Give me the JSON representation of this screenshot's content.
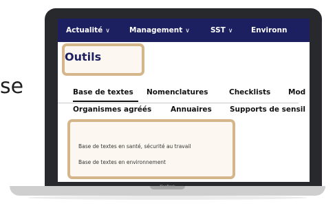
{
  "side_text": "se",
  "nav": {
    "items": [
      {
        "label": "Actualité",
        "chevron": "∨"
      },
      {
        "label": "Management",
        "chevron": "∨"
      },
      {
        "label": "SST",
        "chevron": "∨"
      },
      {
        "label": "Environn",
        "chevron": ""
      }
    ]
  },
  "page": {
    "title": "Outils"
  },
  "tabs_row1": [
    "Base de textes",
    "Nomenclatures",
    "Checklists",
    "Mod"
  ],
  "tabs_row2": [
    "Organismes agréés",
    "Annuaires",
    "Supports de sensil"
  ],
  "links": [
    "Base de textes en santé, sécurité au travail",
    "Base de textes en environnement"
  ],
  "device": {
    "brand": "MacBook"
  },
  "colors": {
    "nav_bg": "#1c2060",
    "highlight": "#d4b68a"
  }
}
